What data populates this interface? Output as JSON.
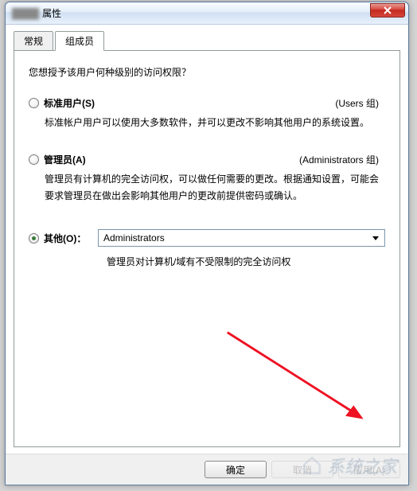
{
  "window": {
    "title_suffix": "属性"
  },
  "tabs": [
    {
      "label": "常规"
    },
    {
      "label": "组成员"
    }
  ],
  "prompt": "您想授予该用户何种级别的访问权限？",
  "options": {
    "standard": {
      "label": "标准用户(S)",
      "group": "(Users 组)",
      "desc": "标准帐户用户可以使用大多数软件，并可以更改不影响其他用户的系统设置。"
    },
    "admin": {
      "label": "管理员(A)",
      "group": "(Administrators 组)",
      "desc": "管理员有计算机的完全访问权，可以做任何需要的更改。根据通知设置，可能会要求管理员在做出会影响其他用户的更改前提供密码或确认。"
    },
    "other": {
      "label": "其他(O)：",
      "selected": "Administrators",
      "desc": "管理员对计算机/域有不受限制的完全访问权"
    }
  },
  "buttons": {
    "ok": "确定",
    "cancel": "取消",
    "apply": "应用(A)"
  }
}
